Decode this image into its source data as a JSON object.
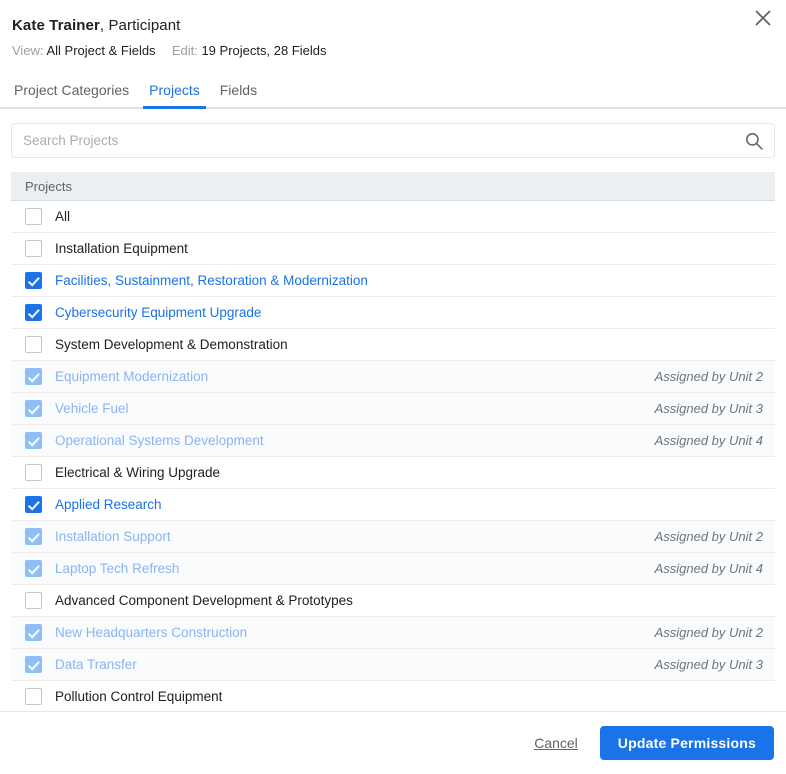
{
  "dialog": {
    "close_icon": "close-icon"
  },
  "header": {
    "person_name": "Kate Trainer",
    "person_role": ", Participant",
    "view_label": "View:",
    "view_value": "All Project & Fields",
    "edit_label": "Edit:",
    "edit_value": "19 Projects, 28 Fields"
  },
  "tabs": [
    {
      "label": "Project Categories",
      "active": false
    },
    {
      "label": "Projects",
      "active": true
    },
    {
      "label": "Fields",
      "active": false
    }
  ],
  "search": {
    "placeholder": "Search Projects",
    "value": "",
    "icon": "search-icon"
  },
  "list": {
    "column_header": "Projects",
    "rows": [
      {
        "label": "All",
        "checked": false,
        "disabled": false,
        "note": ""
      },
      {
        "label": "Installation Equipment",
        "checked": false,
        "disabled": false,
        "note": ""
      },
      {
        "label": "Facilities, Sustainment, Restoration & Modernization",
        "checked": true,
        "disabled": false,
        "note": ""
      },
      {
        "label": "Cybersecurity Equipment Upgrade",
        "checked": true,
        "disabled": false,
        "note": ""
      },
      {
        "label": "System Development & Demonstration",
        "checked": false,
        "disabled": false,
        "note": ""
      },
      {
        "label": "Equipment Modernization",
        "checked": true,
        "disabled": true,
        "note": "Assigned by Unit 2"
      },
      {
        "label": "Vehicle Fuel",
        "checked": true,
        "disabled": true,
        "note": "Assigned by Unit 3"
      },
      {
        "label": "Operational Systems Development",
        "checked": true,
        "disabled": true,
        "note": "Assigned by Unit 4"
      },
      {
        "label": "Electrical & Wiring Upgrade",
        "checked": false,
        "disabled": false,
        "note": ""
      },
      {
        "label": "Applied Research",
        "checked": true,
        "disabled": false,
        "note": ""
      },
      {
        "label": "Installation Support",
        "checked": true,
        "disabled": true,
        "note": "Assigned by Unit 2"
      },
      {
        "label": "Laptop Tech Refresh",
        "checked": true,
        "disabled": true,
        "note": "Assigned by Unit 4"
      },
      {
        "label": "Advanced Component Development & Prototypes",
        "checked": false,
        "disabled": false,
        "note": ""
      },
      {
        "label": "New Headquarters Construction",
        "checked": true,
        "disabled": true,
        "note": "Assigned by Unit 2"
      },
      {
        "label": "Data Transfer",
        "checked": true,
        "disabled": true,
        "note": "Assigned by Unit 3"
      },
      {
        "label": "Pollution Control Equipment",
        "checked": false,
        "disabled": false,
        "note": ""
      }
    ]
  },
  "footer": {
    "cancel_label": "Cancel",
    "submit_label": "Update Permissions"
  },
  "colors": {
    "accent": "#1a73e8",
    "accent_muted": "#8ab4f2",
    "header_row_bg": "#eceff1",
    "disabled_row_bg": "#fafbfc"
  }
}
